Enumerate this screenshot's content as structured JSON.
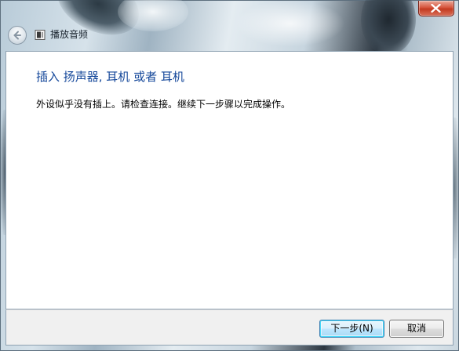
{
  "window": {
    "title": "播放音频"
  },
  "content": {
    "heading": "插入 扬声器, 耳机 或者 耳机",
    "message": "外设似乎没有插上。请检查连接。继续下一步骤以完成操作。"
  },
  "footer": {
    "next_label": "下一步(N)",
    "cancel_label": "取消"
  },
  "icons": {
    "close": "close-icon",
    "back": "back-arrow-icon",
    "app": "speaker-icon"
  },
  "colors": {
    "heading": "#14479a",
    "close_button": "#c23a20",
    "default_button_border": "#3c7fb1"
  }
}
